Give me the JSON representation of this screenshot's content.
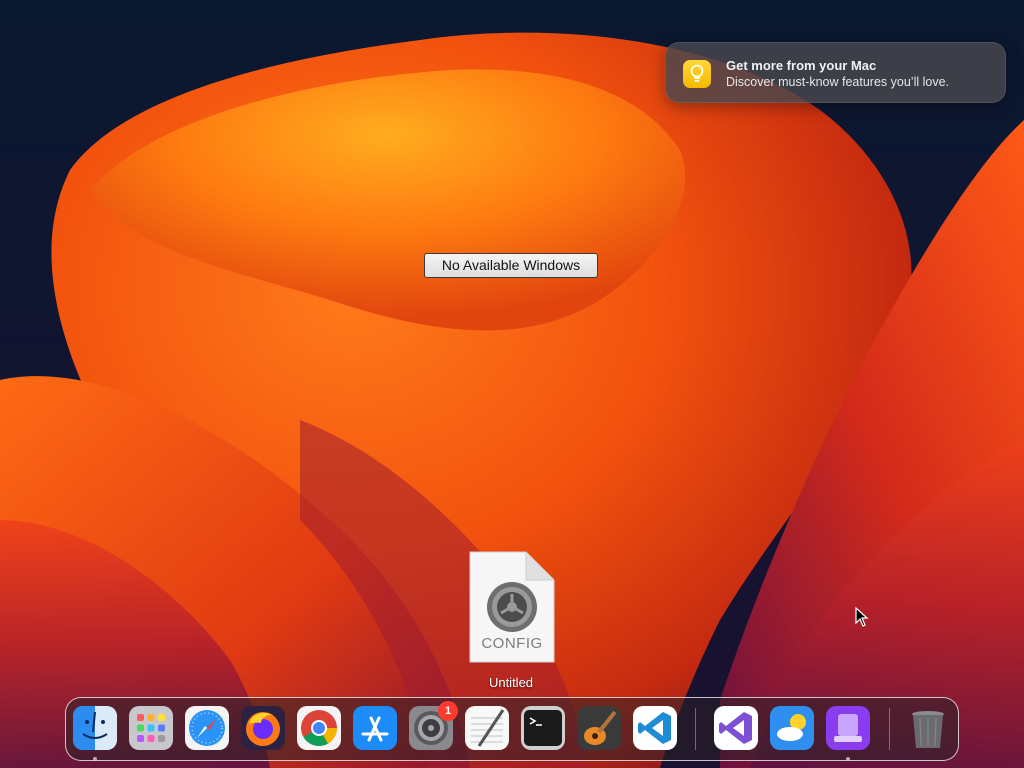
{
  "notification": {
    "title": "Get more from your Mac",
    "body": "Discover must-know features you’ll love.",
    "icon": "lightbulb-icon"
  },
  "desktop": {
    "status_label": "No Available Windows",
    "file": {
      "icon_text": "CONFIG",
      "name": "Untitled",
      "icon": "gear-icon"
    }
  },
  "dock": {
    "items": [
      {
        "name": "Finder",
        "icon": "finder-icon",
        "running": true
      },
      {
        "name": "Launchpad",
        "icon": "launchpad-icon",
        "running": false
      },
      {
        "name": "Safari",
        "icon": "safari-icon",
        "running": false
      },
      {
        "name": "Firefox",
        "icon": "firefox-icon",
        "running": false
      },
      {
        "name": "Chrome",
        "icon": "chrome-icon",
        "running": false
      },
      {
        "name": "App Store",
        "icon": "app-store-icon",
        "running": false
      },
      {
        "name": "System Settings",
        "icon": "system-settings-icon",
        "badge": "1",
        "running": false
      },
      {
        "name": "TextEdit",
        "icon": "textedit-icon",
        "running": false
      },
      {
        "name": "Terminal",
        "icon": "terminal-icon",
        "running": false
      },
      {
        "name": "GarageBand",
        "icon": "garageband-icon",
        "running": false
      },
      {
        "name": "VS Code",
        "icon": "vscode-icon",
        "running": false
      },
      {
        "name": "Visual Studio",
        "icon": "visual-studio-icon",
        "running": false
      },
      {
        "name": "Weather",
        "icon": "weather-icon",
        "running": false
      },
      {
        "name": "Simulator",
        "icon": "simulator-icon",
        "running": true
      },
      {
        "name": "Trash",
        "icon": "trash-icon",
        "running": false
      }
    ]
  },
  "colors": {
    "badge": "#ff3b30",
    "notification_icon": "#f5b800"
  }
}
